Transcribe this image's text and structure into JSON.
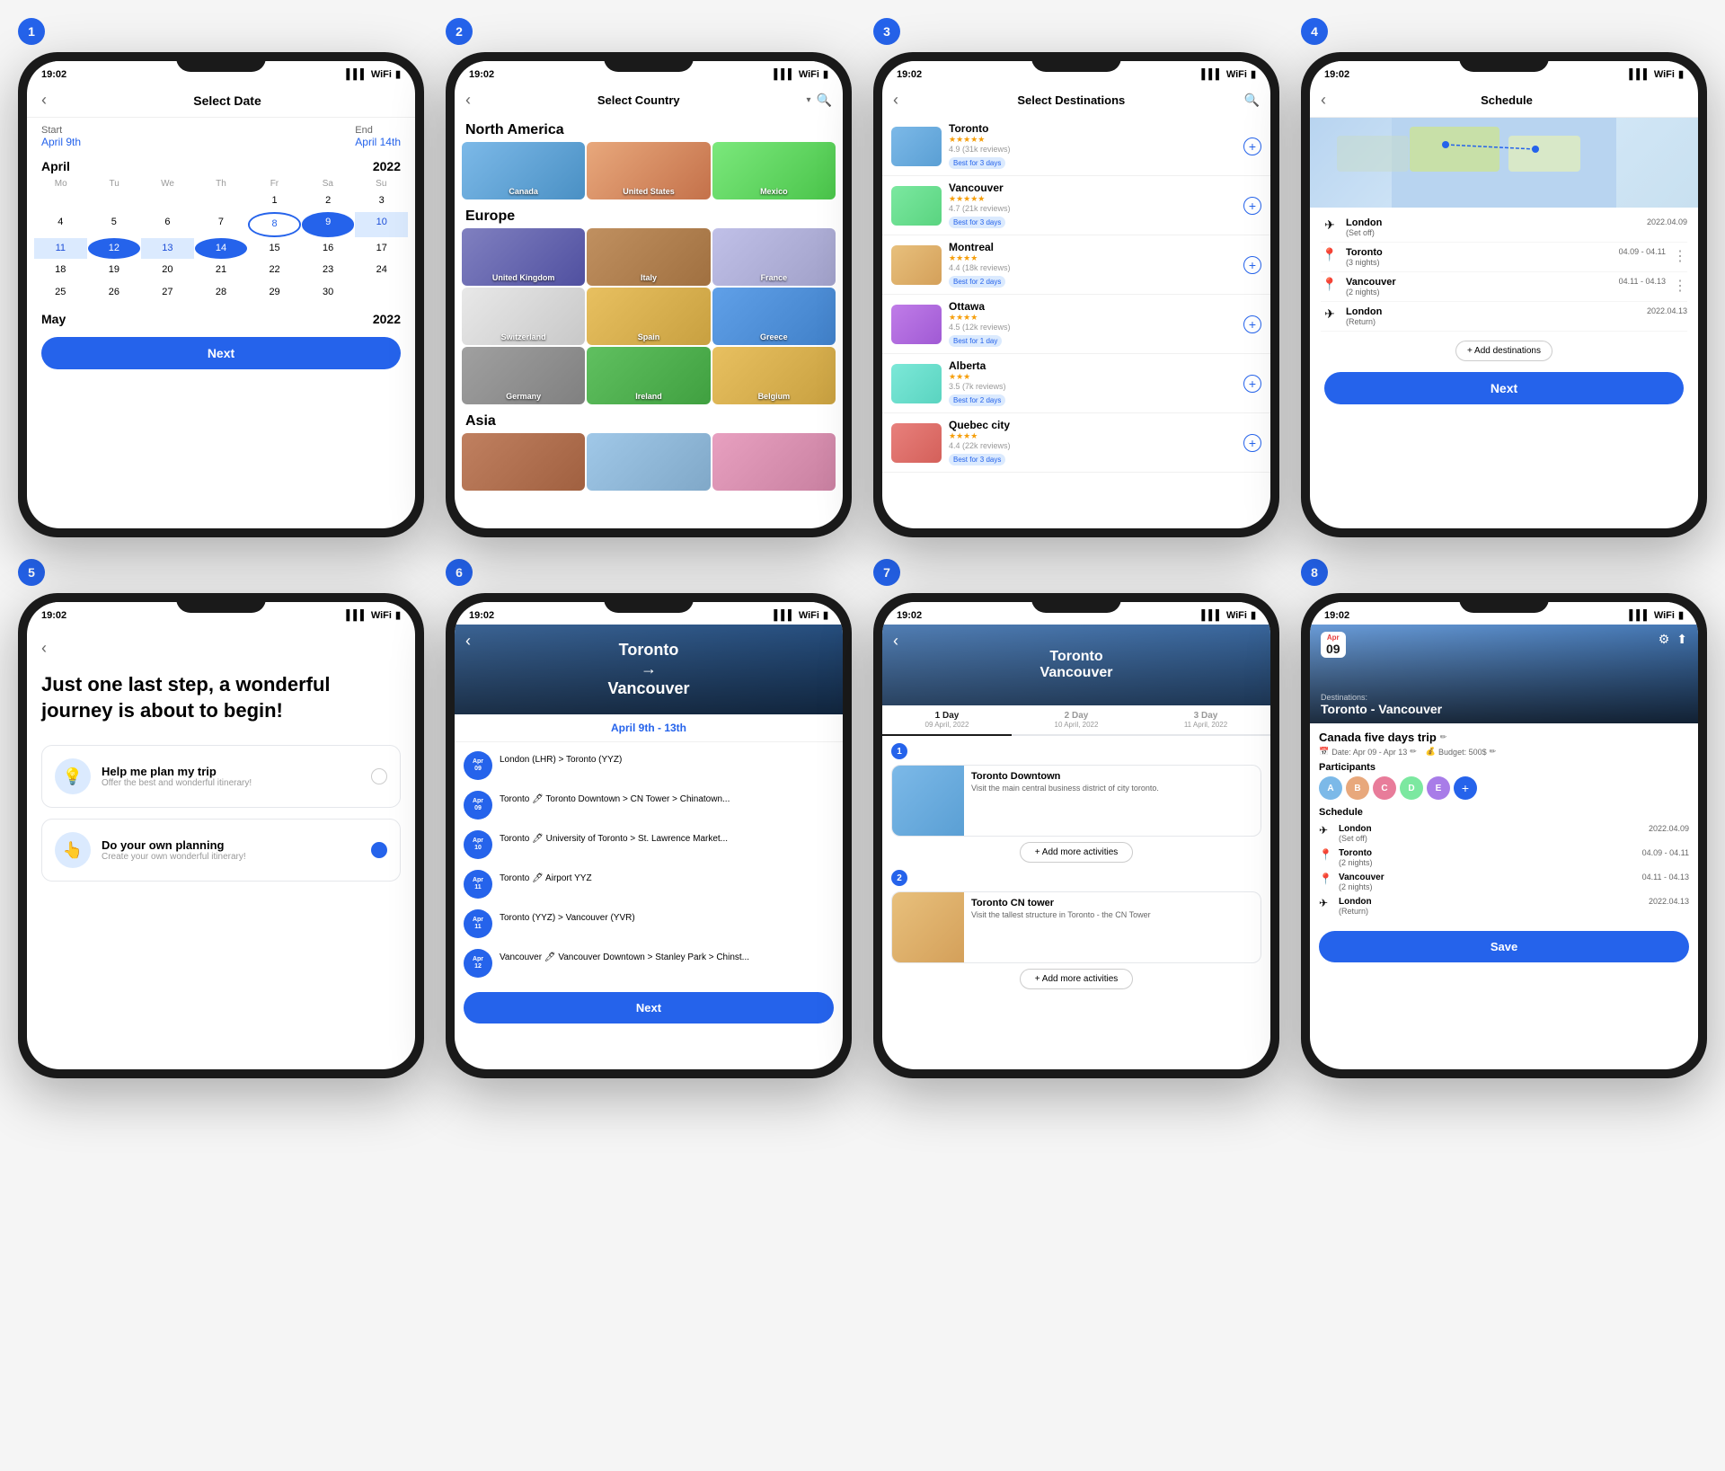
{
  "steps": [
    {
      "number": "1"
    },
    {
      "number": "2"
    },
    {
      "number": "3"
    },
    {
      "number": "4"
    },
    {
      "number": "5"
    },
    {
      "number": "6"
    },
    {
      "number": "7"
    },
    {
      "number": "8"
    }
  ],
  "screen1": {
    "status_time": "19:02",
    "header_title": "Select Date",
    "start_label": "Start",
    "start_date": "April 9th",
    "end_label": "End",
    "end_date": "April 14th",
    "month1": "April",
    "year1": "2022",
    "weekdays": [
      "Mo",
      "Tu",
      "We",
      "Th",
      "Fr",
      "Sa",
      "Su"
    ],
    "april_rows": [
      [
        "",
        "",
        "",
        "",
        "1",
        "2",
        "3"
      ],
      [
        "4",
        "5",
        "6",
        "7",
        "8",
        "9",
        "10"
      ],
      [
        "11",
        "12",
        "13",
        "14",
        "15",
        "16",
        "17"
      ],
      [
        "18",
        "19",
        "20",
        "21",
        "22",
        "23",
        "24"
      ],
      [
        "25",
        "26",
        "27",
        "28",
        "29",
        "30",
        ""
      ]
    ],
    "month2": "May",
    "year2": "2022",
    "next_label": "Next"
  },
  "screen2": {
    "status_time": "19:02",
    "header_title": "Select Country",
    "region1": "North America",
    "countries_na": [
      {
        "label": "Canada"
      },
      {
        "label": "United States"
      },
      {
        "label": "Mexico"
      }
    ],
    "region2": "Europe",
    "countries_eu": [
      {
        "label": "United Kingdom"
      },
      {
        "label": "Italy"
      },
      {
        "label": "France"
      },
      {
        "label": "Switzerland"
      },
      {
        "label": "Spain"
      },
      {
        "label": "Greece"
      },
      {
        "label": "Germany"
      },
      {
        "label": "Ireland"
      },
      {
        "label": "Belgium"
      }
    ],
    "region3": "Asia"
  },
  "screen3": {
    "status_time": "19:02",
    "header_title": "Select Destinations",
    "destinations": [
      {
        "name": "Toronto",
        "stars": "★★★★★",
        "reviews": "4.9 (31k reviews)",
        "badge": "Best for 3 days"
      },
      {
        "name": "Vancouver",
        "stars": "★★★★★",
        "reviews": "4.7 (21k reviews)",
        "badge": "Best for 3 days"
      },
      {
        "name": "Montreal",
        "stars": "★★★★",
        "reviews": "4.4 (18k reviews)",
        "badge": "Best for 2 days"
      },
      {
        "name": "Ottawa",
        "stars": "★★★★",
        "reviews": "4.5 (12k reviews)",
        "badge": "Best for 1 day"
      },
      {
        "name": "Alberta",
        "stars": "★★★",
        "reviews": "3.5 (7k reviews)",
        "badge": "Best for 2 days"
      },
      {
        "name": "Quebec city",
        "stars": "★★★★",
        "reviews": "4.4 (22k reviews)",
        "badge": "Best for 3 days"
      }
    ]
  },
  "screen4": {
    "status_time": "19:02",
    "header_title": "Schedule",
    "schedule_items": [
      {
        "icon": "✈",
        "name": "London",
        "note": "(Set off)",
        "date": "2022.04.09",
        "dots": false
      },
      {
        "icon": "📍",
        "name": "Toronto",
        "note": "(3 nights)",
        "date": "04.09 - 04.11",
        "dots": true
      },
      {
        "icon": "📍",
        "name": "Vancouver",
        "note": "(2 nights)",
        "date": "04.11 - 04.13",
        "dots": true
      },
      {
        "icon": "✈",
        "name": "London",
        "note": "(Return)",
        "date": "2022.04.13",
        "dots": false
      }
    ],
    "add_destinations": "+ Add destinations",
    "next_label": "Next"
  },
  "screen5": {
    "status_time": "19:02",
    "title": "Just one last step, a wonderful journey is about to begin!",
    "option1_title": "Help me plan my trip",
    "option1_sub": "Offer the best and wonderful itinerary!",
    "option2_title": "Do your own planning",
    "option2_sub": "Create your own wonderful itinerary!"
  },
  "screen6": {
    "status_time": "19:02",
    "title_line1": "Toronto",
    "title_arrow": "→",
    "title_line2": "Vancouver",
    "date_range": "April 9th - 13th",
    "items": [
      {
        "month": "Apr",
        "day": "09",
        "text": "London (LHR) > Toronto (YYZ)"
      },
      {
        "month": "Apr",
        "day": "09",
        "text": "Toronto 🖊 Toronto Downtown > CN Tower > Chinatown..."
      },
      {
        "month": "Apr",
        "day": "10",
        "text": "Toronto 🖊 University of Toronto > St. Lawrence Market..."
      },
      {
        "month": "Apr",
        "day": "11",
        "text": "Toronto 🖊 Airport YYZ"
      },
      {
        "month": "Apr",
        "day": "11",
        "text": "Toronto (YYZ) > Vancouver (YVR)"
      },
      {
        "month": "Apr",
        "day": "12",
        "text": "Vancouver 🖊 Vancouver Downtown > Stanley Park > Chinst..."
      }
    ],
    "next_label": "Next"
  },
  "screen7": {
    "status_time": "19:02",
    "title_line1": "Toronto",
    "title_line2": "Vancouver",
    "tabs": [
      {
        "label": "1 Day",
        "date": "09 April, 2022"
      },
      {
        "label": "2 Day",
        "date": "10 April, 2022"
      },
      {
        "label": "3 Day",
        "date": "11 April, 2022"
      }
    ],
    "activity1_name": "Toronto Downtown",
    "activity1_desc": "Visit the main central business district of city toronto.",
    "add_btn1": "+ Add more activities",
    "activity2_name": "Toronto CN tower",
    "activity2_desc": "Visit the tallest structure in Toronto - the CN Tower",
    "add_btn2": "+ Add more activities"
  },
  "screen8": {
    "status_time": "19:02",
    "date_month": "Apr",
    "date_day": "09",
    "destinations_label": "Destinations:",
    "route": "Toronto - Vancouver",
    "trip_name": "Canada five days trip",
    "date_range": "Date: Apr 09 - Apr 13",
    "budget": "Budget: 500$",
    "participants_label": "Participants",
    "participants": [
      {
        "color": "#7cb9e8",
        "initial": "A"
      },
      {
        "color": "#e8a87c",
        "initial": "B"
      },
      {
        "color": "#e87c9a",
        "initial": "C"
      },
      {
        "color": "#7ce8a0",
        "initial": "D"
      },
      {
        "color": "#a87ce8",
        "initial": "E"
      }
    ],
    "schedule_label": "Schedule",
    "schedule_items": [
      {
        "icon": "✈",
        "name": "London",
        "note": "(Set off)",
        "dates": "2022.04.09"
      },
      {
        "icon": "📍",
        "name": "Toronto",
        "note": "(2 nights)",
        "dates": "04.09 - 04.11"
      },
      {
        "icon": "📍",
        "name": "Vancouver",
        "note": "(2 nights)",
        "dates": "04.11 - 04.13"
      },
      {
        "icon": "✈",
        "name": "London",
        "note": "(Return)",
        "dates": "2022.04.13"
      }
    ],
    "save_label": "Save"
  }
}
